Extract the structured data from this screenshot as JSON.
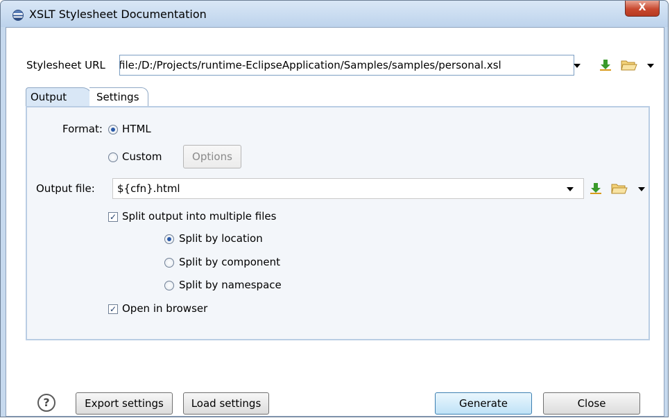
{
  "window": {
    "title": "XSLT Stylesheet Documentation",
    "close_glyph": "X"
  },
  "stylesheet": {
    "label": "Stylesheet URL",
    "value": "file:/D:/Projects/runtime-EclipseApplication/Samples/samples/personal.xsl"
  },
  "tabs": [
    {
      "label": "Output",
      "selected": true
    },
    {
      "label": "Settings",
      "selected": false
    }
  ],
  "output": {
    "format_label": "Format:",
    "format_options": [
      {
        "label": "HTML",
        "selected": true
      },
      {
        "label": "Custom",
        "selected": false
      }
    ],
    "options_button": "Options",
    "output_file_label": "Output file:",
    "output_file_value": "${cfn}.html",
    "split_checkbox": {
      "label": "Split output into multiple files",
      "checked": true
    },
    "split_options": [
      {
        "label": "Split by location",
        "selected": true
      },
      {
        "label": "Split by component",
        "selected": false
      },
      {
        "label": "Split by namespace",
        "selected": false
      }
    ],
    "open_browser": {
      "label": "Open in browser",
      "checked": true
    }
  },
  "footer": {
    "export_label": "Export settings",
    "load_label": "Load settings",
    "generate_label": "Generate",
    "close_label": "Close",
    "help_glyph": "?"
  },
  "icons": [
    "eclipse-icon",
    "download-icon",
    "folder-icon",
    "chevron-down-icon",
    "help-icon"
  ],
  "colors": {
    "accent": "#2a5aa8",
    "panel_border": "#b9cde4",
    "titlebar": "#c6d9ee",
    "close_button": "#c8482f"
  }
}
